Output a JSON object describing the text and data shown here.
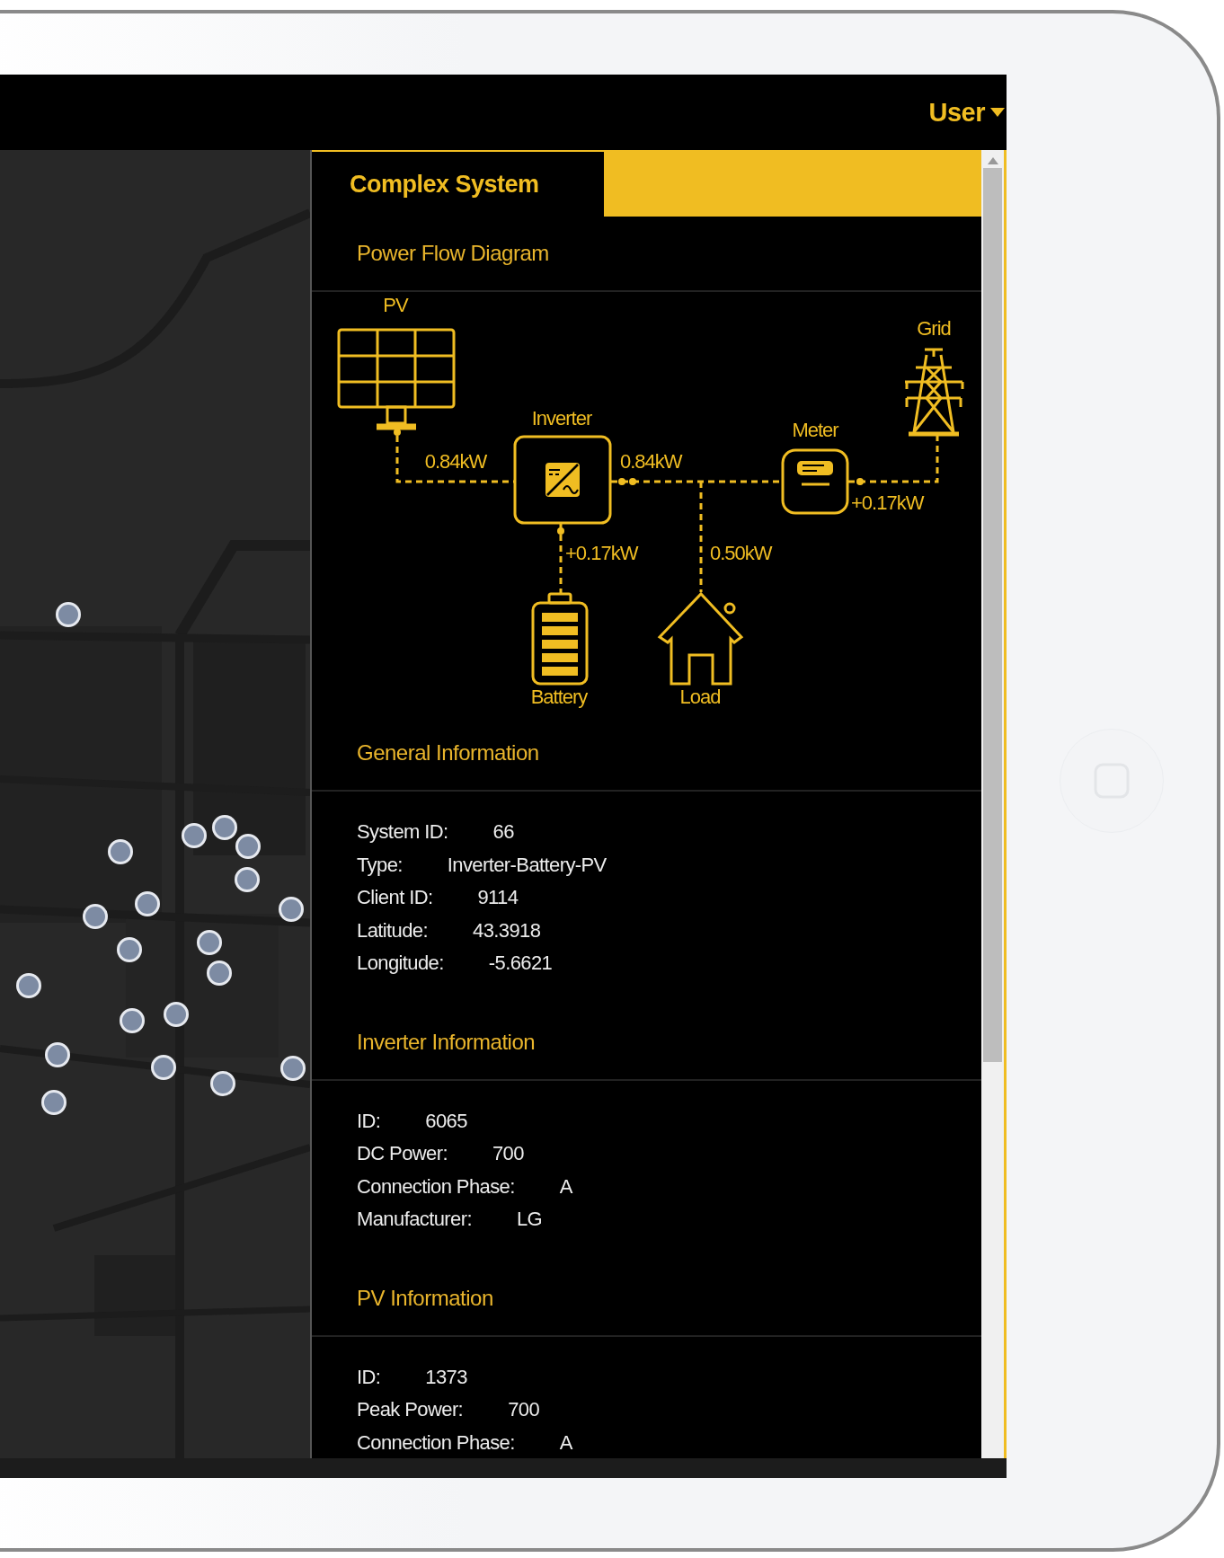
{
  "top_bar": {
    "user_menu": {
      "label": "User"
    }
  },
  "panel": {
    "title": "Complex System",
    "power_flow": {
      "title": "Power Flow Diagram",
      "nodes": [
        {
          "kind": "pv",
          "label": "PV"
        },
        {
          "kind": "inverter",
          "label": "Inverter"
        },
        {
          "kind": "meter",
          "label": "Meter"
        },
        {
          "kind": "grid",
          "label": "Grid"
        },
        {
          "kind": "battery",
          "label": "Battery"
        },
        {
          "kind": "load",
          "label": "Load"
        }
      ],
      "flows": [
        {
          "kind": "pv_inverter",
          "reading": "0.84kW"
        },
        {
          "kind": "inverter_meter",
          "reading": "0.84kW"
        },
        {
          "kind": "meter_grid",
          "reading": "+0.17kW"
        },
        {
          "kind": "inverter_battery",
          "reading": "+0.17kW"
        },
        {
          "kind": "bus_load",
          "reading": "0.50kW"
        }
      ]
    },
    "sections": [
      {
        "title": "General Information",
        "fields": [
          {
            "label": "System ID:",
            "value": "66"
          },
          {
            "label": "Type:",
            "value": "Inverter-Battery-PV"
          },
          {
            "label": "Client ID:",
            "value": "9114"
          },
          {
            "label": "Latitude:",
            "value": "43.3918"
          },
          {
            "label": "Longitude:",
            "value": "-5.6621"
          }
        ]
      },
      {
        "title": "Inverter Information",
        "fields": [
          {
            "label": "ID:",
            "value": "6065"
          },
          {
            "label": "DC Power:",
            "value": "700"
          },
          {
            "label": "Connection Phase:",
            "value": "A"
          },
          {
            "label": "Manufacturer:",
            "value": "LG"
          }
        ]
      },
      {
        "title": "PV Information",
        "fields": [
          {
            "label": "ID:",
            "value": "1373"
          },
          {
            "label": "Peak Power:",
            "value": "700"
          },
          {
            "label": "Connection Phase:",
            "value": "A"
          }
        ]
      }
    ]
  }
}
